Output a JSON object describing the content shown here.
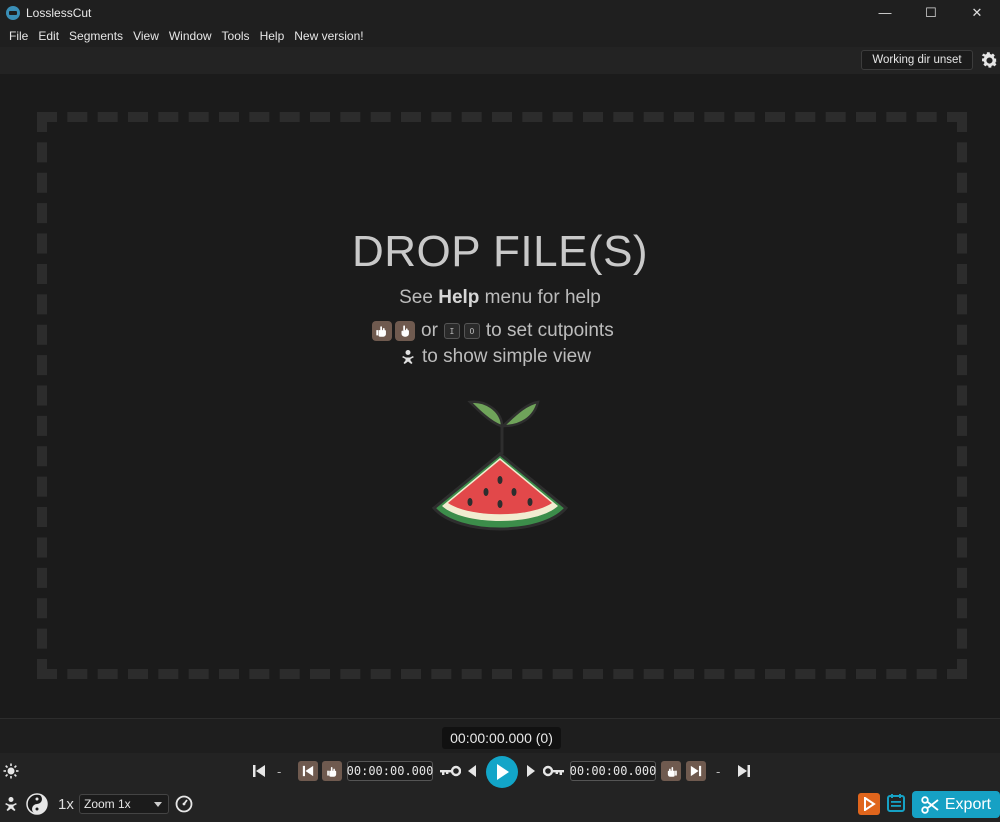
{
  "window": {
    "title": "LosslessCut",
    "minimize_glyph": "—",
    "maximize_glyph": "☐",
    "close_glyph": "✕"
  },
  "menu": [
    "File",
    "Edit",
    "Segments",
    "View",
    "Window",
    "Tools",
    "Help",
    "New version!"
  ],
  "topbar": {
    "working_dir_label": "Working dir unset",
    "settings_icon": "gear-icon"
  },
  "dropzone": {
    "title": "DROP FILE(S)",
    "help_prefix": "See ",
    "help_bold": "Help",
    "help_suffix": " menu for help",
    "cutpoint_or": "or",
    "cutpoint_key_in": "I",
    "cutpoint_key_out": "O",
    "cutpoint_suffix": "to set cutpoints",
    "simple_view_text": "to show simple view",
    "logo_icon": "watermelon-icon"
  },
  "timeline": {
    "current_time": "00:00:00.000 (0)"
  },
  "controls": {
    "dash": "-",
    "cut_start_time": "00:00:00.000",
    "cut_end_time": "00:00:00.000",
    "playback_rate": "1x",
    "zoom_value": "Zoom 1x",
    "export_label": "Export"
  },
  "colors": {
    "accent": "#12a5c8",
    "cut_button": "#6f5a4f",
    "export_icon_orange": "#e0651c",
    "background": "#1b1b1b"
  }
}
